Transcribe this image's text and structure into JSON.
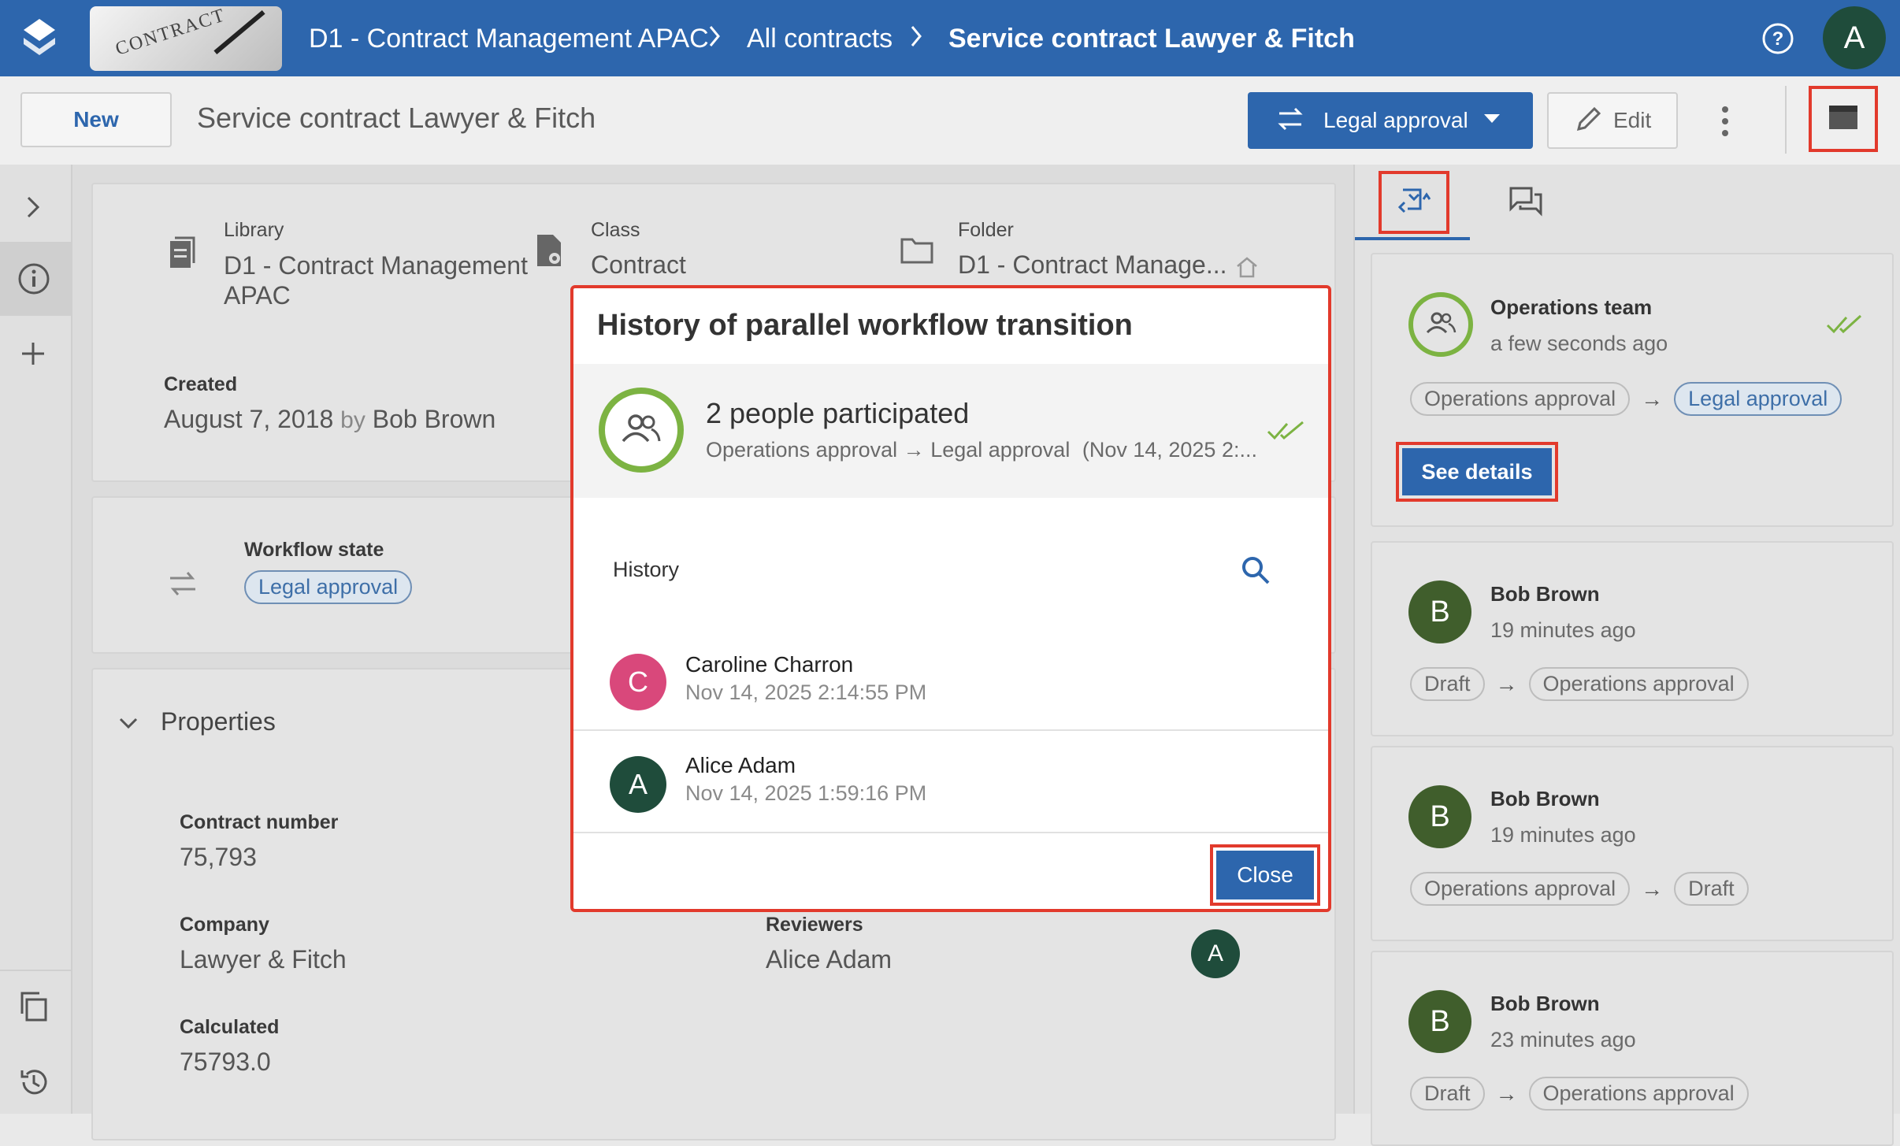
{
  "topbar": {
    "crumbs": [
      "D1 - Contract Management APAC",
      "All contracts",
      "Service contract Lawyer & Fitch"
    ],
    "avatar_letter": "A",
    "thumbnail_text": "CONTRACT",
    "brand_color": "#2d66ad"
  },
  "toolbar": {
    "new_label": "New",
    "doc_title": "Service contract Lawyer & Fitch",
    "workflow_label": "Legal approval",
    "edit_label": "Edit"
  },
  "summary": {
    "library_label": "Library",
    "library_value": "D1 - Contract Management APAC",
    "class_label": "Class",
    "class_value": "Contract",
    "folder_label": "Folder",
    "folder_value": "D1 - Contract Manage...",
    "created_label": "Created",
    "created_date": "August 7, 2018",
    "created_by": "by",
    "created_user": "Bob Brown"
  },
  "workflow": {
    "label": "Workflow state",
    "state": "Legal approval"
  },
  "properties": {
    "title": "Properties",
    "contract_number_label": "Contract number",
    "contract_number_value": "75,793",
    "company_label": "Company",
    "company_value": "Lawyer & Fitch",
    "calculated_label": "Calculated",
    "calculated_value": "75793.0",
    "reviewers_label": "Reviewers",
    "reviewers_value": "Alice Adam",
    "reviewer_avatar": "A"
  },
  "modal": {
    "title": "History of parallel workflow transition",
    "participants": "2 people participated",
    "transition_from": "Operations approval",
    "arrow": "→",
    "transition_to": "Legal approval",
    "transition_time": "(Nov 14, 2025 2:...",
    "history_label": "History",
    "entries": [
      {
        "initial": "C",
        "name": "Caroline Charron",
        "time": "Nov 14, 2025 2:14:55 PM",
        "color": "#d9487b"
      },
      {
        "initial": "A",
        "name": "Alice Adam",
        "time": "Nov 14, 2025 1:59:16 PM",
        "color": "#1f4c3b"
      }
    ],
    "close_label": "Close"
  },
  "activity": [
    {
      "title": "Operations team",
      "time": "a few seconds ago",
      "from": "Operations approval",
      "arrow": "→",
      "to": "Legal approval",
      "button": "See details"
    },
    {
      "initial": "B",
      "title": "Bob Brown",
      "time": "19 minutes ago",
      "from": "Draft",
      "arrow": "→",
      "to": "Operations approval"
    },
    {
      "initial": "B",
      "title": "Bob Brown",
      "time": "19 minutes ago",
      "from": "Operations approval",
      "arrow": "→",
      "to": "Draft"
    },
    {
      "initial": "B",
      "title": "Bob Brown",
      "time": "23 minutes ago",
      "from": "Draft",
      "arrow": "→",
      "to": "Operations approval"
    }
  ],
  "colors": {
    "accent": "#2d66ad",
    "highlight": "#e23a2c",
    "success": "#7cb342",
    "avatar_dark": "#1f4c3b"
  }
}
